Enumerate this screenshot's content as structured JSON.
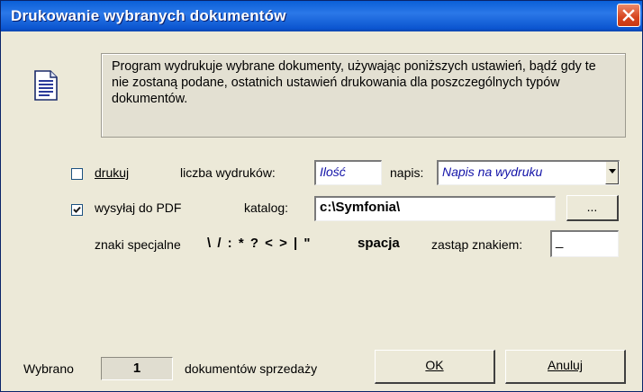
{
  "window": {
    "title": "Drukowanie wybranych dokumentów"
  },
  "info": {
    "text": "Program wydrukuje wybrane dokumenty, używając poniższych ustawień, bądź gdy te nie zostaną podane, ostatnich ustawień drukowania dla poszczególnych typów dokumentów."
  },
  "print_row": {
    "checkbox_label": "drukuj",
    "checked": false,
    "copies_label": "liczba wydruków:",
    "copies_placeholder": "Ilość",
    "caption_label": "napis:",
    "caption_placeholder": "Napis na wydruku"
  },
  "pdf_row": {
    "checkbox_label": "wysyłaj do PDF",
    "checked": true,
    "folder_label": "katalog:",
    "folder_value": "c:\\Symfonia\\",
    "browse_label": "..."
  },
  "special_row": {
    "label": "znaki specjalne",
    "chars": "\\ / : * ? < > | \"",
    "space_word": "spacja",
    "replace_label": "zastąp znakiem:",
    "replace_value": "_"
  },
  "footer": {
    "selected_label": "Wybrano",
    "selected_count": "1",
    "docs_label": "dokumentów sprzedaży",
    "ok_label": "OK",
    "cancel_label": "Anuluj"
  },
  "colors": {
    "titlebar": "#0a5fd8",
    "background": "#ece9d8",
    "placeholder_text": "#1313a8",
    "close_button": "#d6451f"
  }
}
